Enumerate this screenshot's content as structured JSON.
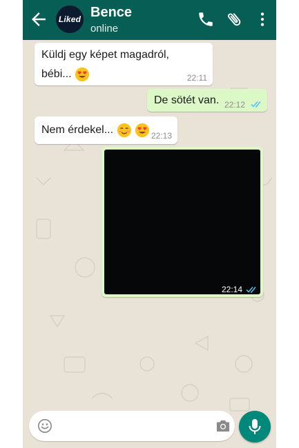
{
  "contact": {
    "name": "Bence",
    "status": "online",
    "avatar_text": "Liked"
  },
  "messages": [
    {
      "direction": "in",
      "lines": [
        "Küldj egy képet magadról,",
        "bébi..."
      ],
      "time": "22:11"
    },
    {
      "direction": "out",
      "text": "De sötét van.",
      "time": "22:12",
      "status": "read"
    },
    {
      "direction": "in",
      "text": "Nem érdekel...",
      "time": "22:13"
    },
    {
      "direction": "out",
      "type": "image",
      "time": "22:14",
      "status": "read"
    }
  ],
  "icons": {
    "back": "arrow-left-icon",
    "call": "phone-icon",
    "attach": "paperclip-icon",
    "menu": "more-vert-icon",
    "emoji": "emoji-icon",
    "camera": "camera-icon",
    "mic": "microphone-icon"
  },
  "colors": {
    "header": "#075e54",
    "incoming_bubble": "#ffffff",
    "outgoing_bubble": "#dcf8c6",
    "read_ticks": "#4fc3f7",
    "mic_button": "#00897b",
    "chat_background": "#e9e2d6"
  }
}
